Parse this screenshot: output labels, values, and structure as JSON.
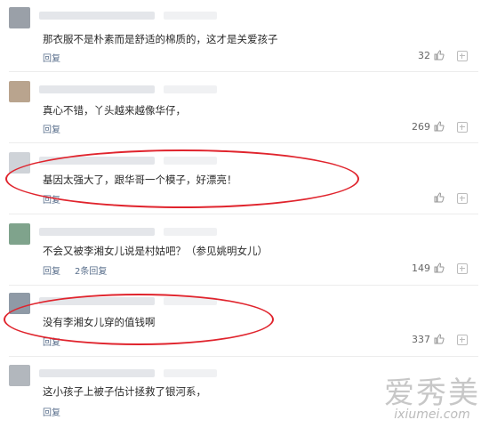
{
  "comments": [
    {
      "text": "那衣服不是朴素而是舒适的棉质的，这才是关爱孩子",
      "reply": "回复",
      "extra": "",
      "count": "32",
      "avatar_color": "#9aa0a8"
    },
    {
      "text": "真心不错，丫头越来越像华仔，",
      "reply": "回复",
      "extra": "",
      "count": "269",
      "avatar_color": "#b9a48e"
    },
    {
      "text": "基因太强大了，跟华哥一个模子，好漂亮！",
      "reply": "回复",
      "extra": "",
      "count": "",
      "avatar_color": "#cfd3d8"
    },
    {
      "text": "不会又被李湘女儿说是村姑吧？（参见姚明女儿）",
      "reply": "回复",
      "extra": "2条回复",
      "count": "149",
      "avatar_color": "#7fa38c"
    },
    {
      "text": "没有李湘女儿穿的值钱啊",
      "reply": "回复",
      "extra": "",
      "count": "337",
      "avatar_color": "#8f9aa6"
    },
    {
      "text": "这小孩子上被子估计拯救了银河系，",
      "reply": "回复",
      "extra": "",
      "count": "",
      "avatar_color": "#b2b7bd"
    }
  ],
  "watermark": {
    "main": "爱秀美",
    "sub": "ixiumei.com"
  },
  "colors": {
    "highlight_oval": "#e0242d",
    "reply_link": "#5a6f8c"
  },
  "icons": {
    "like": "thumbs-up-icon",
    "more": "plus-box-icon"
  }
}
